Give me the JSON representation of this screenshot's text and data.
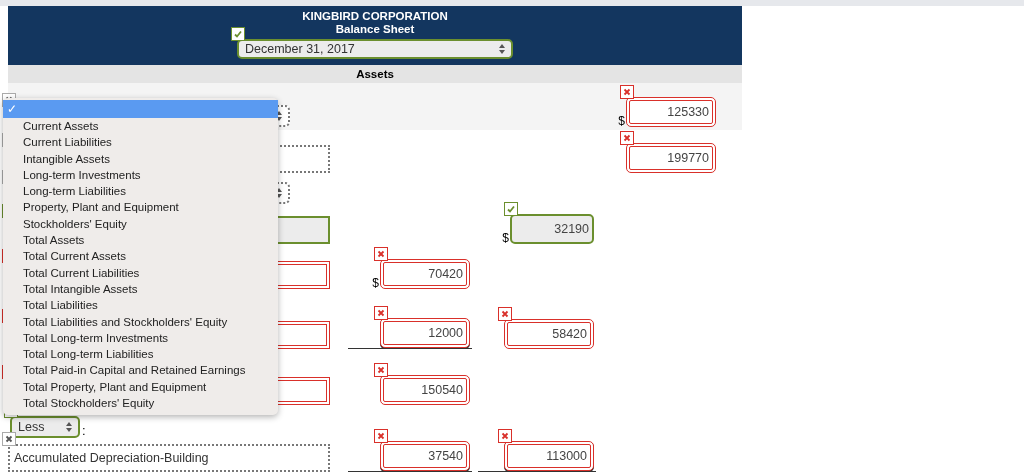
{
  "header": {
    "company": "KINGBIRD CORPORATION",
    "title": "Balance Sheet",
    "date_select": {
      "value": "December 31, 2017",
      "answered": true,
      "correct": true
    }
  },
  "section": "Assets",
  "rows": [
    {
      "label": {
        "kind": "select",
        "answered": false
      },
      "amount_3": {
        "value": "125330",
        "answered": true,
        "correct": false,
        "dollar": "$",
        "underline": false
      }
    },
    {
      "label": {
        "kind": "text",
        "answered": false
      },
      "amount_3": {
        "value": "199770",
        "answered": true,
        "correct": false,
        "underline": false
      }
    },
    {
      "label": {
        "kind": "select",
        "answered": false
      }
    },
    {
      "label": {
        "kind": "text",
        "answered": true,
        "correct": true
      },
      "amount_2": {
        "value": "32190",
        "answered": true,
        "correct": true,
        "dollar": "$",
        "underline": false
      }
    },
    {
      "label": {
        "kind": "text",
        "answered": true,
        "correct": false
      },
      "amount_1": {
        "value": "70420",
        "answered": true,
        "correct": false,
        "dollar": "$",
        "underline": false
      }
    },
    {
      "label": {
        "kind": "text",
        "answered": true,
        "correct": false
      },
      "amount_1": {
        "value": "12000",
        "answered": true,
        "correct": false,
        "underline": true
      },
      "amount_2": {
        "value": "58420",
        "answered": true,
        "correct": false,
        "underline": false
      }
    },
    {
      "label": {
        "kind": "text",
        "answered": true,
        "correct": false
      },
      "amount_1": {
        "value": "150540",
        "answered": true,
        "correct": false,
        "underline": false
      }
    },
    {
      "label": {
        "kind": "short-select",
        "value": "Less",
        "answered": true,
        "correct": true,
        "suffix": ":"
      }
    },
    {
      "label": {
        "kind": "text",
        "value": "Accumulated Depreciation-Building",
        "answered": false
      },
      "amount_1": {
        "value": "37540",
        "answered": true,
        "correct": false,
        "underline": true
      },
      "amount_2": {
        "value": "113000",
        "answered": true,
        "correct": false,
        "underline": true
      }
    }
  ],
  "menu": {
    "items": [
      {
        "check": "✓",
        "selected": true
      },
      {
        "label": "Current Assets",
        "selected": false
      },
      {
        "label": "Current Liabilities",
        "selected": false
      },
      {
        "label": "Intangible Assets",
        "selected": false
      },
      {
        "label": "Long-term Investments",
        "selected": false
      },
      {
        "label": "Long-term Liabilities",
        "selected": false
      },
      {
        "label": "Property, Plant and Equipment",
        "selected": false
      },
      {
        "label": "Stockholders' Equity",
        "selected": false
      },
      {
        "label": "Total Assets",
        "selected": false
      },
      {
        "label": "Total Current Assets",
        "selected": false
      },
      {
        "label": "Total Current Liabilities",
        "selected": false
      },
      {
        "label": "Total Intangible Assets",
        "selected": false
      },
      {
        "label": "Total Liabilities",
        "selected": false
      },
      {
        "label": "Total Liabilities and Stockholders' Equity",
        "selected": false
      },
      {
        "label": "Total Long-term Investments",
        "selected": false
      },
      {
        "label": "Total Long-term Liabilities",
        "selected": false
      },
      {
        "label": "Total Paid-in Capital and Retained Earnings",
        "selected": false
      },
      {
        "label": "Total Property, Plant and Equipment",
        "selected": false
      },
      {
        "label": "Total Stockholders' Equity",
        "selected": false
      }
    ]
  }
}
